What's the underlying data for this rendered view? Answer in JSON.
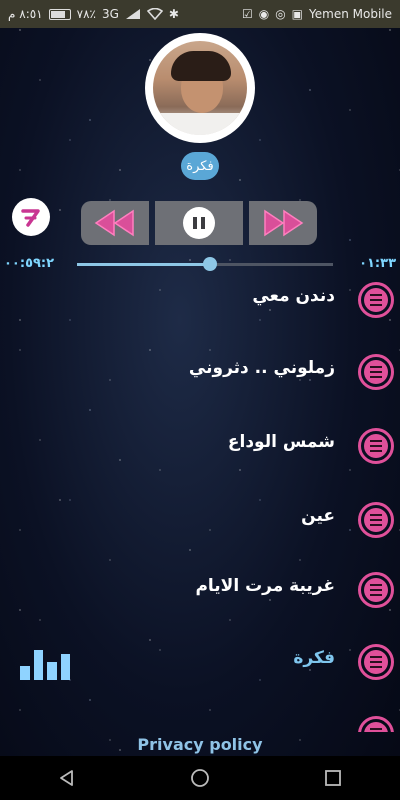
{
  "status_bar": {
    "time": "٨:٥١ م",
    "battery": "٧٨٪",
    "network_type": "3G",
    "carrier": "Yemen Mobile"
  },
  "player": {
    "now_playing": "فكرة",
    "elapsed": "٠١:٣٣",
    "duration": "٠٠:٥٩:٢",
    "progress_percent": 52
  },
  "songs": [
    {
      "title": "دندن معي",
      "active": false
    },
    {
      "title": "زملوني .. دثروني",
      "active": false
    },
    {
      "title": "شمس الوداع",
      "active": false
    },
    {
      "title": "عين",
      "active": false
    },
    {
      "title": "غريبة مرت الايام",
      "active": false
    },
    {
      "title": "فكرة",
      "active": true
    },
    {
      "title": "",
      "active": false
    }
  ],
  "footer": {
    "privacy_label": "Privacy policy"
  },
  "icons": {
    "app_logo": "seven-logo-icon",
    "prev": "rewind-icon",
    "play": "pause-icon",
    "next": "fast-forward-icon",
    "menu": "menu-lines-icon",
    "equalizer": "equalizer-icon"
  },
  "colors": {
    "accent_pink": "#e0509a",
    "accent_blue": "#7fc6ee",
    "control_bg": "#6e7076"
  }
}
